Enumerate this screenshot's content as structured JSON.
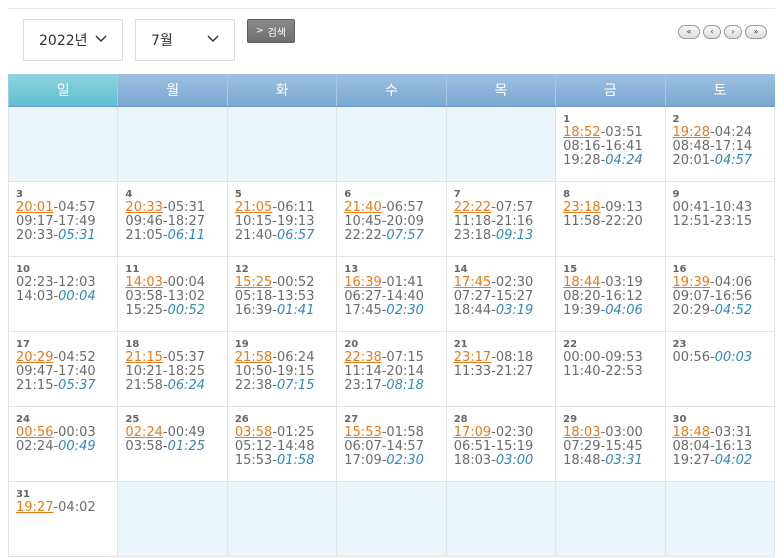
{
  "controls": {
    "year_value": "2022년",
    "month_value": "7월",
    "search_label": "검색",
    "nav": [
      "«",
      "‹",
      "›",
      "»"
    ]
  },
  "weekdays": [
    "일",
    "월",
    "화",
    "수",
    "목",
    "금",
    "토"
  ],
  "weeks": [
    [
      null,
      null,
      null,
      null,
      null,
      {
        "day": "1",
        "rise": "18:52",
        "set": "-03:51",
        "l2": "08:16-16:41",
        "l3a": "19:28-",
        "l3b": "04:24"
      },
      {
        "day": "2",
        "rise": "19:28",
        "set": "-04:24",
        "l2": "08:48-17:14",
        "l3a": "20:01-",
        "l3b": "04:57"
      }
    ],
    [
      {
        "day": "3",
        "rise": "20:01",
        "set": "-04:57",
        "l2": "09:17-17:49",
        "l3a": "20:33-",
        "l3b": "05:31"
      },
      {
        "day": "4",
        "rise": "20:33",
        "set": "-05:31",
        "l2": "09:46-18:27",
        "l3a": "21:05-",
        "l3b": "06:11"
      },
      {
        "day": "5",
        "rise": "21:05",
        "set": "-06:11",
        "l2": "10:15-19:13",
        "l3a": "21:40-",
        "l3b": "06:57"
      },
      {
        "day": "6",
        "rise": "21:40",
        "set": "-06:57",
        "l2": "10:45-20:09",
        "l3a": "22:22-",
        "l3b": "07:57"
      },
      {
        "day": "7",
        "rise": "22:22",
        "set": "-07:57",
        "l2": "11:18-21:16",
        "l3a": "23:18-",
        "l3b": "09:13"
      },
      {
        "day": "8",
        "rise": "23:18",
        "set": "-09:13",
        "l2": "11:58-22:20",
        "l3a": "",
        "l3b": ""
      },
      {
        "day": "9",
        "rise": "",
        "set": "00:41-10:43",
        "l2": "12:51-23:15",
        "l3a": "",
        "l3b": ""
      }
    ],
    [
      {
        "day": "10",
        "rise": "",
        "set": "02:23-12:03",
        "l2": "14:03-",
        "l2b": "00:04",
        "l3a": "",
        "l3b": ""
      },
      {
        "day": "11",
        "rise": "14:03",
        "set": "-00:04",
        "l2": "03:58-13:02",
        "l3a": "15:25-",
        "l3b": "00:52"
      },
      {
        "day": "12",
        "rise": "15:25",
        "set": "-00:52",
        "l2": "05:18-13:53",
        "l3a": "16:39-",
        "l3b": "01:41"
      },
      {
        "day": "13",
        "rise": "16:39",
        "set": "-01:41",
        "l2": "06:27-14:40",
        "l3a": "17:45-",
        "l3b": "02:30"
      },
      {
        "day": "14",
        "rise": "17:45",
        "set": "-02:30",
        "l2": "07:27-15:27",
        "l3a": "18:44-",
        "l3b": "03:19"
      },
      {
        "day": "15",
        "rise": "18:44",
        "set": "-03:19",
        "l2": "08:20-16:12",
        "l3a": "19:39-",
        "l3b": "04:06"
      },
      {
        "day": "16",
        "rise": "19:39",
        "set": "-04:06",
        "l2": "09:07-16:56",
        "l3a": "20:29-",
        "l3b": "04:52"
      }
    ],
    [
      {
        "day": "17",
        "rise": "20:29",
        "set": "-04:52",
        "l2": "09:47-17:40",
        "l3a": "21:15-",
        "l3b": "05:37"
      },
      {
        "day": "18",
        "rise": "21:15",
        "set": "-05:37",
        "l2": "10:21-18:25",
        "l3a": "21:58-",
        "l3b": "06:24"
      },
      {
        "day": "19",
        "rise": "21:58",
        "set": "-06:24",
        "l2": "10:50-19:15",
        "l3a": "22:38-",
        "l3b": "07:15"
      },
      {
        "day": "20",
        "rise": "22:38",
        "set": "-07:15",
        "l2": "11:14-20:14",
        "l3a": "23:17-",
        "l3b": "08:18"
      },
      {
        "day": "21",
        "rise": "23:17",
        "set": "-08:18",
        "l2": "11:33-21:27",
        "l3a": "",
        "l3b": ""
      },
      {
        "day": "22",
        "rise": "",
        "set": "00:00-09:53",
        "l2": "11:40-22:53",
        "l3a": "",
        "l3b": ""
      },
      {
        "day": "23",
        "rise": "",
        "set": "00:56-",
        "setb": "00:03",
        "l2": "",
        "l3a": "",
        "l3b": ""
      }
    ],
    [
      {
        "day": "24",
        "rise": "00:56",
        "set": "-00:03",
        "l2": "02:24-",
        "l2b": "00:49",
        "l3a": "",
        "l3b": ""
      },
      {
        "day": "25",
        "rise": "02:24",
        "set": "-00:49",
        "l2": "03:58-",
        "l2b": "01:25",
        "l3a": "",
        "l3b": ""
      },
      {
        "day": "26",
        "rise": "03:58",
        "set": "-01:25",
        "l2": "05:12-14:48",
        "l3a": "15:53-",
        "l3b": "01:58"
      },
      {
        "day": "27",
        "rise": "15:53",
        "set": "-01:58",
        "l2": "06:07-14:57",
        "l3a": "17:09-",
        "l3b": "02:30"
      },
      {
        "day": "28",
        "rise": "17:09",
        "set": "-02:30",
        "l2": "06:51-15:19",
        "l3a": "18:03-",
        "l3b": "03:00"
      },
      {
        "day": "29",
        "rise": "18:03",
        "set": "-03:00",
        "l2": "07:29-15:45",
        "l3a": "18:48-",
        "l3b": "03:31"
      },
      {
        "day": "30",
        "rise": "18:48",
        "set": "-03:31",
        "l2": "08:04-16:13",
        "l3a": "19:27-",
        "l3b": "04:02"
      }
    ],
    [
      {
        "day": "31",
        "rise": "19:27",
        "set": "-04:02",
        "l2": "",
        "l3a": "",
        "l3b": ""
      },
      null,
      null,
      null,
      null,
      null,
      null
    ]
  ],
  "colors": {
    "header": "#7aa7d1",
    "sunday_header": "#5ec0d2",
    "rise": "#e37a1c",
    "moon": "#3388b6",
    "empty_cell": "#eaf6f9"
  }
}
